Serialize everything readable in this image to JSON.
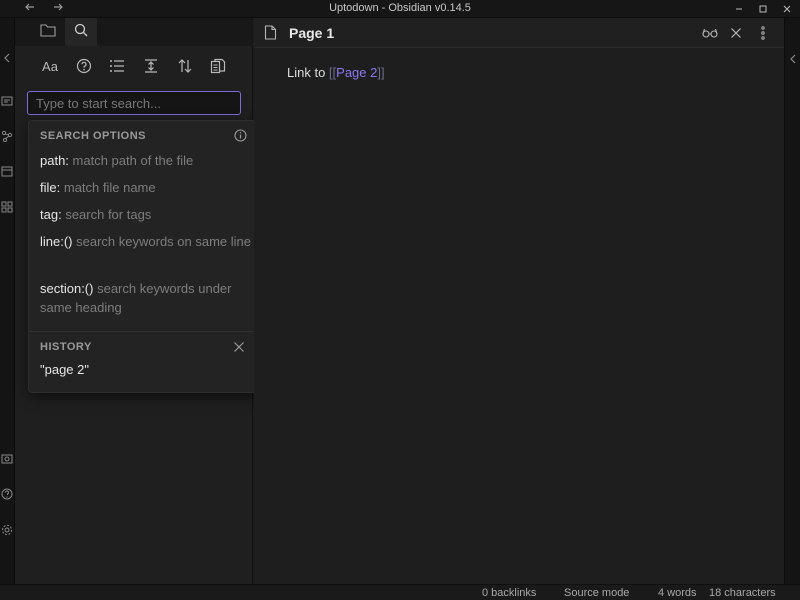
{
  "window": {
    "title": "Uptodown - Obsidian v0.14.5",
    "back_icon": "arrow-left-icon",
    "forward_icon": "arrow-right-icon"
  },
  "sidebar": {
    "tabs": [
      {
        "name": "file-explorer",
        "icon": "folder-icon",
        "active": false
      },
      {
        "name": "search",
        "icon": "search-icon",
        "active": true
      }
    ],
    "search_tools": [
      {
        "name": "match-case",
        "label": "Aa"
      },
      {
        "name": "explain-search",
        "icon": "help-circle-icon"
      },
      {
        "name": "show-context",
        "icon": "list-icon"
      },
      {
        "name": "collapse-results",
        "icon": "collapse-icon"
      },
      {
        "name": "sort-results",
        "icon": "sort-icon"
      },
      {
        "name": "copy-results",
        "icon": "copy-icon"
      }
    ],
    "search": {
      "placeholder": "Type to start search...",
      "value": ""
    }
  },
  "search_options": {
    "heading": "SEARCH OPTIONS",
    "items": [
      {
        "key": "path:",
        "desc": "match path of the file"
      },
      {
        "key": "file:",
        "desc": "match file name"
      },
      {
        "key": "tag:",
        "desc": "search for tags"
      },
      {
        "key": "line:()",
        "desc": "search keywords on same line"
      },
      {
        "key": "section:()",
        "desc": "search keywords under same heading"
      }
    ],
    "history_heading": "HISTORY",
    "history": [
      "\"page 2\""
    ]
  },
  "editor": {
    "page_title": "Page 1",
    "content_prefix": "Link to ",
    "link_open": "[[",
    "link_text": "Page 2",
    "link_close": "]]"
  },
  "statusbar": {
    "backlinks": "0 backlinks",
    "mode": "Source mode",
    "words": "4 words",
    "characters": "18 characters"
  },
  "colors": {
    "accent": "#7b6cd9",
    "link": "#8a78f0",
    "background": "#1e1e1e"
  }
}
